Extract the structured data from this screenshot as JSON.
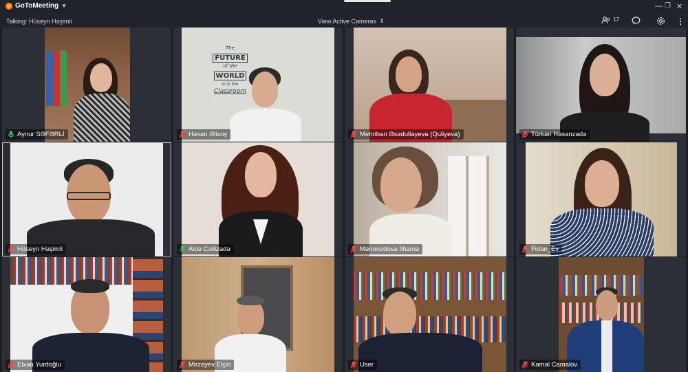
{
  "app": {
    "brand": "GoToMeeting",
    "window_controls": [
      "minimize-icon",
      "restore-icon",
      "close-icon"
    ]
  },
  "toolbar": {
    "talking_label": "Talking: Hüseyn Həşimli",
    "view_mode": "View Active Cameras",
    "attendee_count": "17",
    "icons": [
      "attendees-icon",
      "chat-icon",
      "settings-icon",
      "more-icon"
    ]
  },
  "participants": [
    {
      "name": "Aynur SƏFƏRLİ",
      "mic": "on"
    },
    {
      "name": "Həsən Əlisoy",
      "mic": "muted"
    },
    {
      "name": "Mehriban Əsədullayeva  (Quliyeva)",
      "mic": "muted"
    },
    {
      "name": "Türkan Həsənzadə",
      "mic": "muted"
    },
    {
      "name": "Hüseyn Həşimli",
      "mic": "muted"
    },
    {
      "name": "Aidə Cəlilzadə",
      "mic": "on"
    },
    {
      "name": "Məmmədova İlhamə",
      "mic": "muted"
    },
    {
      "name": "Fidan_Ev",
      "mic": "muted"
    },
    {
      "name": "Elxan Yurdoğlu",
      "mic": "muted"
    },
    {
      "name": "Mirzəyev Elçin",
      "mic": "muted"
    },
    {
      "name": "User",
      "mic": "muted"
    },
    {
      "name": "Kamal Camalov",
      "mic": "muted"
    }
  ],
  "backdrop_text": [
    "The",
    "FUTURE",
    "of the",
    "WORLD",
    "is in the",
    "Classroom"
  ],
  "colors": {
    "mic_on": "#2fd06a",
    "mic_muted": "#ff4a4a",
    "background": "#1b1d22"
  }
}
